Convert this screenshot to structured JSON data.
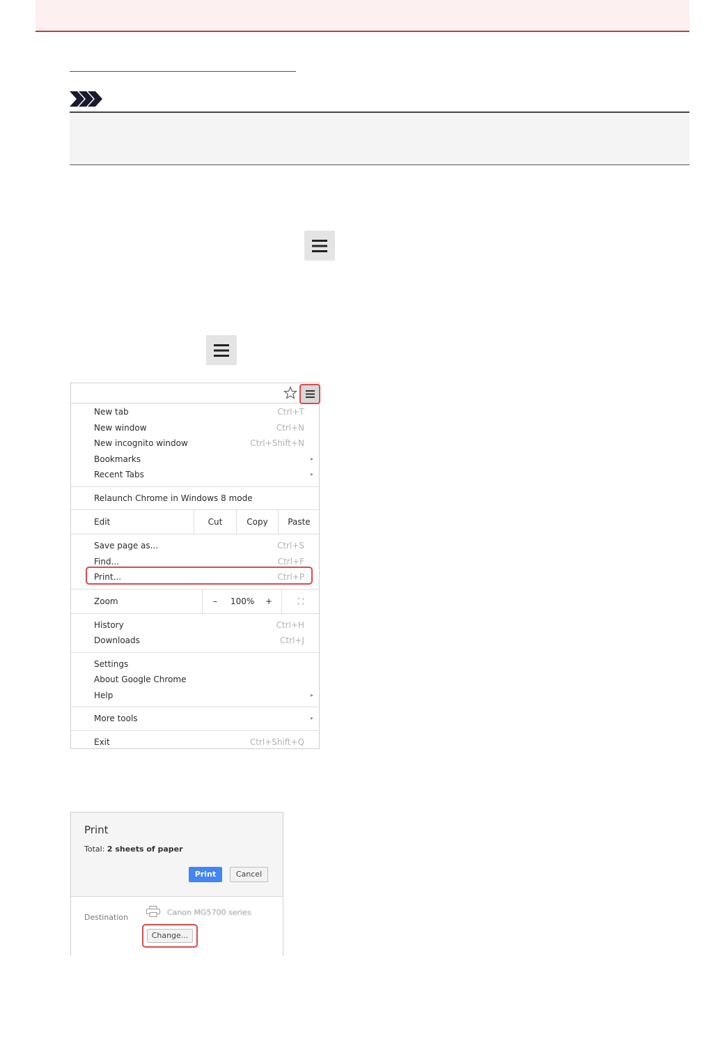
{
  "chrome_menu": {
    "group1": [
      {
        "label": "New tab",
        "shortcut": "Ctrl+T"
      },
      {
        "label": "New window",
        "shortcut": "Ctrl+N"
      },
      {
        "label": "New incognito window",
        "shortcut": "Ctrl+Shift+N"
      },
      {
        "label": "Bookmarks",
        "submenu": "▸"
      },
      {
        "label": "Recent Tabs",
        "submenu": "▸"
      }
    ],
    "relaunch": {
      "label": "Relaunch Chrome in Windows 8 mode"
    },
    "edit": {
      "label": "Edit",
      "cut": "Cut",
      "copy": "Copy",
      "paste": "Paste"
    },
    "group3": [
      {
        "label": "Save page as...",
        "shortcut": "Ctrl+S"
      },
      {
        "label": "Find...",
        "shortcut": "Ctrl+F"
      },
      {
        "label": "Print...",
        "shortcut": "Ctrl+P"
      }
    ],
    "zoom": {
      "label": "Zoom",
      "minus": "–",
      "value": "100%",
      "plus": "+",
      "fullscreen": "⛶"
    },
    "group5": [
      {
        "label": "History",
        "shortcut": "Ctrl+H"
      },
      {
        "label": "Downloads",
        "shortcut": "Ctrl+J"
      }
    ],
    "group6": [
      {
        "label": "Settings"
      },
      {
        "label": "About Google Chrome"
      },
      {
        "label": "Help",
        "submenu": "▸"
      }
    ],
    "more_tools": {
      "label": "More tools",
      "submenu": "▸"
    },
    "exit": {
      "label": "Exit",
      "shortcut": "Ctrl+Shift+Q"
    }
  },
  "print_dialog": {
    "title": "Print",
    "total_prefix": "Total: ",
    "total_value": "2 sheets of paper",
    "print_button": "Print",
    "cancel_button": "Cancel",
    "destination_label": "Destination",
    "printer_name": "Canon MG5700 series",
    "change_button": "Change..."
  },
  "colors": {
    "header_bg": "#fdf0f0",
    "header_rule": "#c33b3b",
    "highlight": "#d94b4b",
    "print_blue": "#4285f4"
  },
  "icons": {
    "note": "note-arrows-icon",
    "menu": "hamburger-menu-icon",
    "star": "star-outline-icon",
    "printer": "printer-icon"
  }
}
